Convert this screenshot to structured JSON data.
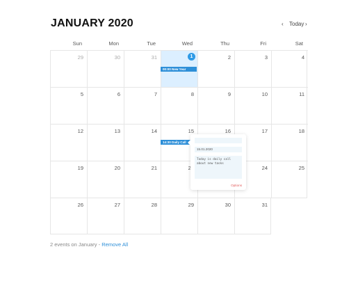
{
  "header": {
    "title": "JANUARY 2020",
    "prev": "‹",
    "today": "Today",
    "next": "›"
  },
  "weekdays": [
    "Sun",
    "Mon",
    "Tue",
    "Wed",
    "Thu",
    "Fri",
    "Sat"
  ],
  "weeks": [
    [
      "29",
      "30",
      "31",
      "1",
      "2",
      "3",
      "4"
    ],
    [
      "5",
      "6",
      "7",
      "8",
      "9",
      "10",
      "11"
    ],
    [
      "12",
      "13",
      "14",
      "15",
      "16",
      "17",
      "18"
    ],
    [
      "19",
      "20",
      "21",
      "22",
      "23",
      "24",
      "25"
    ],
    [
      "26",
      "27",
      "28",
      "29",
      "30",
      "31",
      ""
    ]
  ],
  "events": [
    {
      "label": "00:00 New Year"
    },
    {
      "label": "14:30 Daily Call"
    }
  ],
  "popover": {
    "title_value": "",
    "date_value": "15.01.2020",
    "description": "Today is daily call about new tasks",
    "options_label": "Options"
  },
  "footer": {
    "summary": "2 events on January",
    "separator": " - ",
    "remove_label": "Remove All"
  },
  "colors": {
    "accent": "#2e8fd8",
    "today_bg": "#dcefff",
    "danger": "#e25c5c"
  }
}
